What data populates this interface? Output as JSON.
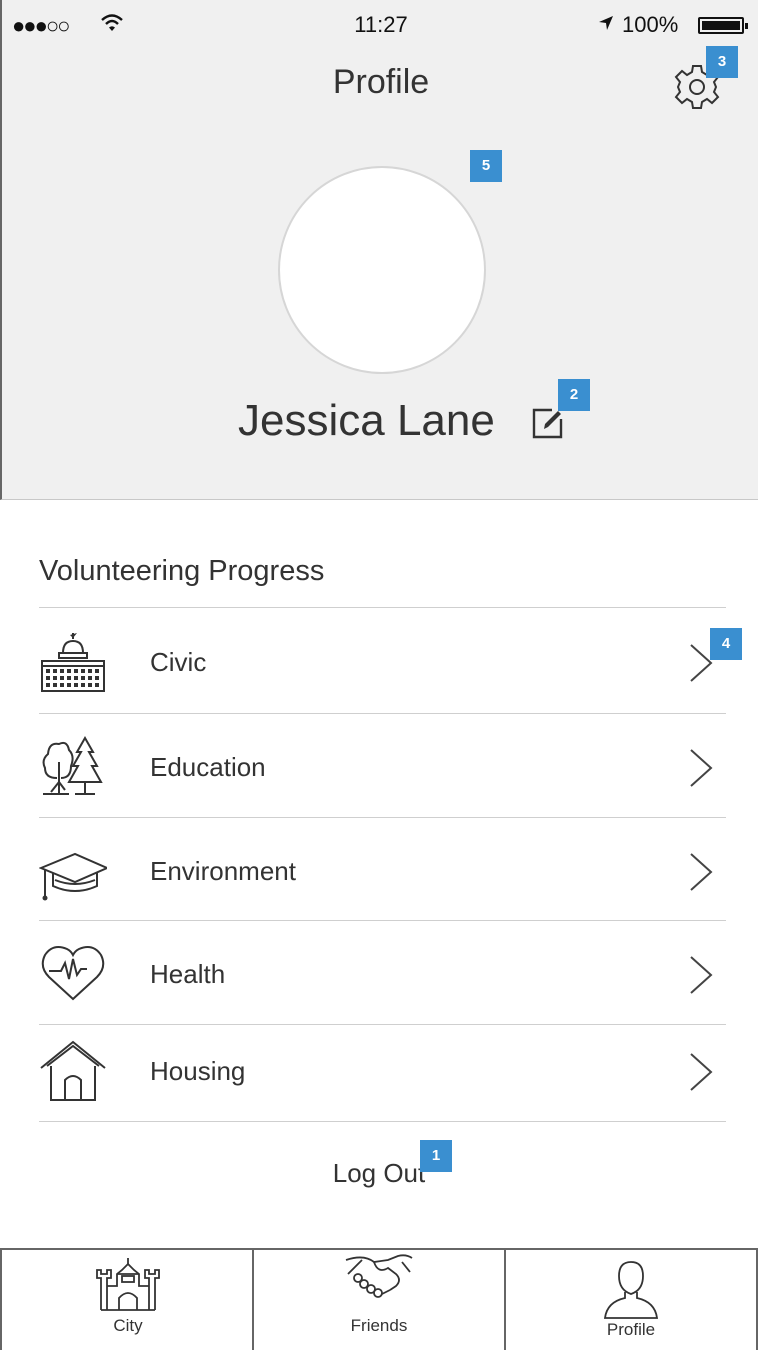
{
  "status_bar": {
    "signal": "●●●○○",
    "time": "11:27",
    "battery": "100%"
  },
  "header": {
    "title": "Profile",
    "settings_icon": "gear-icon"
  },
  "profile": {
    "name": "Jessica Lane",
    "edit_icon": "edit-icon"
  },
  "annotations": {
    "logout": "1",
    "edit": "2",
    "settings": "3",
    "chevron": "4",
    "avatar": "5"
  },
  "progress": {
    "title": "Volunteering Progress",
    "items": [
      {
        "label": "Civic",
        "icon": "capitol-building-icon"
      },
      {
        "label": "Education",
        "icon": "trees-icon"
      },
      {
        "label": "Environment",
        "icon": "graduation-cap-icon"
      },
      {
        "label": "Health",
        "icon": "heart-pulse-icon"
      },
      {
        "label": "Housing",
        "icon": "house-icon"
      }
    ]
  },
  "logout_label": "Log Out",
  "tabbar": {
    "tabs": [
      {
        "label": "City",
        "icon": "castle-icon"
      },
      {
        "label": "Friends",
        "icon": "handshake-icon"
      },
      {
        "label": "Profile",
        "icon": "person-icon"
      }
    ]
  },
  "colors": {
    "header_bg": "#f0f0f0",
    "badge": "#3a8fd0",
    "divider": "#cfcfcf"
  }
}
